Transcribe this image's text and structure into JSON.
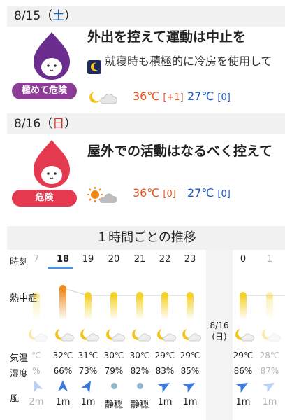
{
  "day1": {
    "date": "8/15",
    "dow_open": "（",
    "dow": "土",
    "dow_close": "）",
    "level": "極めて危険",
    "level_color": "#8e3d97",
    "headline": "外出を控えて運動は中止を",
    "advice": "就寝時も積極的に冷房を使用して",
    "weather_icon": "moon-cloud-icon",
    "temp_hi": "36℃",
    "temp_hi_diff": "[+1]",
    "temp_lo": "27℃",
    "temp_lo_diff": "[0]"
  },
  "day2": {
    "date": "8/16",
    "dow_open": "（",
    "dow": "日",
    "dow_close": "）",
    "level": "危険",
    "level_color": "#e53950",
    "headline": "屋外での活動はなるべく控えて",
    "weather_icon": "sun-cloud-icon",
    "temp_hi": "36℃",
    "temp_hi_diff": "[0]",
    "temp_lo": "27℃",
    "temp_lo_diff": "[0]"
  },
  "hourly": {
    "title": "１時間ごとの推移",
    "labels": {
      "time": "時刻",
      "heat": "熱中症",
      "temp": "気温",
      "humidity": "湿度",
      "wind": "風"
    },
    "divider_date": "8/16",
    "divider_dow": "(日)",
    "hours": [
      "7",
      "18",
      "19",
      "20",
      "21",
      "22",
      "23",
      "0",
      "1"
    ],
    "temps": [
      "℃",
      "32℃",
      "31℃",
      "30℃",
      "30℃",
      "29℃",
      "29℃",
      "29℃",
      "28℃"
    ],
    "humidity": [
      "%",
      "66%",
      "73%",
      "79%",
      "82%",
      "83%",
      "85%",
      "86%",
      "87%"
    ],
    "wind": [
      "2m",
      "1m",
      "1m",
      "静穏",
      "静穏",
      "1m",
      "1m",
      "1m",
      "1m"
    ],
    "heat_levels": [
      "danger",
      "extreme",
      "danger",
      "danger",
      "danger",
      "danger",
      "danger",
      "danger",
      "danger"
    ],
    "colors": {
      "extreme": "#f08a1c",
      "danger": "#f5d22a"
    }
  }
}
